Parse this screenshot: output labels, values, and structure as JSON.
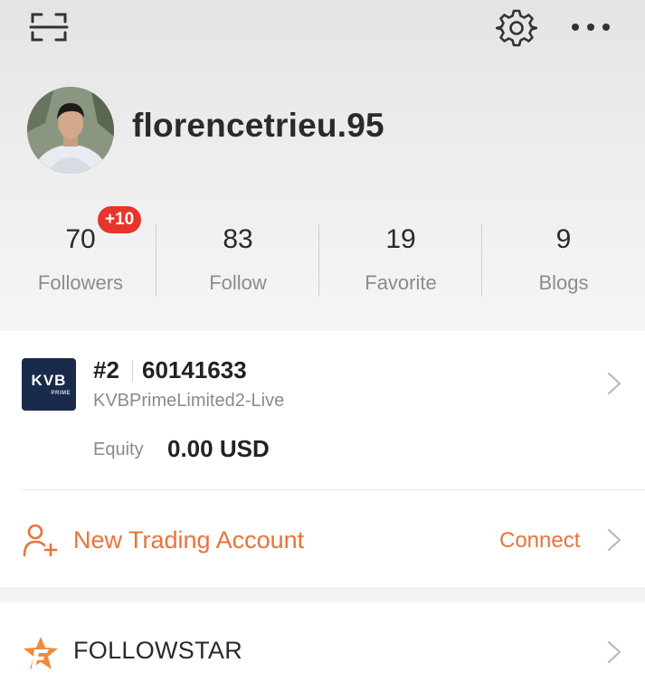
{
  "profile": {
    "username": "florencetrieu.95"
  },
  "stats": [
    {
      "value": "70",
      "label": "Followers",
      "badge": "+10"
    },
    {
      "value": "83",
      "label": "Follow"
    },
    {
      "value": "19",
      "label": "Favorite"
    },
    {
      "value": "9",
      "label": "Blogs"
    }
  ],
  "account": {
    "logo_text": "KVB",
    "logo_subtext": "PRIME",
    "rank": "#2",
    "number": "60141633",
    "server": "KVBPrimeLimited2-Live",
    "equity_label": "Equity",
    "equity_value": "0.00 USD"
  },
  "new_account": {
    "label": "New Trading Account",
    "action": "Connect"
  },
  "followstar": {
    "label": "FOLLOWSTAR"
  },
  "colors": {
    "accent": "#e8733a",
    "badge": "#e8352b",
    "logo_bg": "#1a2a4a"
  },
  "icons": {
    "top_left": "scan-icon",
    "top_right_1": "gear-icon",
    "top_right_2": "more-dots-icon",
    "new_account": "person-plus-icon",
    "followstar": "followstar-icon",
    "row_arrow": "chevron-right-icon"
  }
}
